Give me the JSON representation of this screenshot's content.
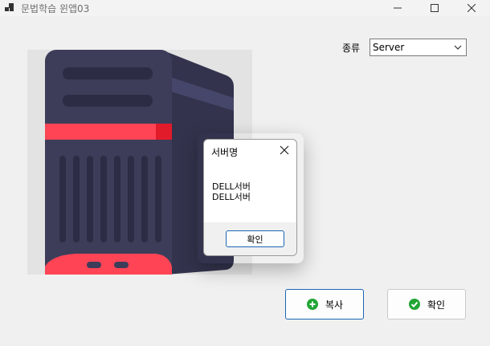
{
  "window": {
    "title": "문법학습 윈앱03",
    "controls": {
      "minimize_icon": "minimize-icon",
      "maximize_icon": "maximize-icon",
      "close_icon": "close-icon"
    }
  },
  "form": {
    "kind_label": "종류",
    "kind_select": {
      "value": "Server"
    },
    "image": {
      "subject": "server-tower-icon"
    },
    "copy_button": {
      "label": "복사",
      "icon": "plus-circle-icon",
      "icon_color": "#22a535"
    },
    "confirm_button": {
      "label": "확인",
      "icon": "check-circle-icon",
      "icon_color": "#22a535"
    }
  },
  "dialog": {
    "title": "서버명",
    "message": "DELL서버\nDELL서버",
    "ok_label": "확인"
  },
  "colors": {
    "accent_border": "#1b67b6",
    "server_red": "#ff4555",
    "server_body": "#3d3d5a"
  }
}
